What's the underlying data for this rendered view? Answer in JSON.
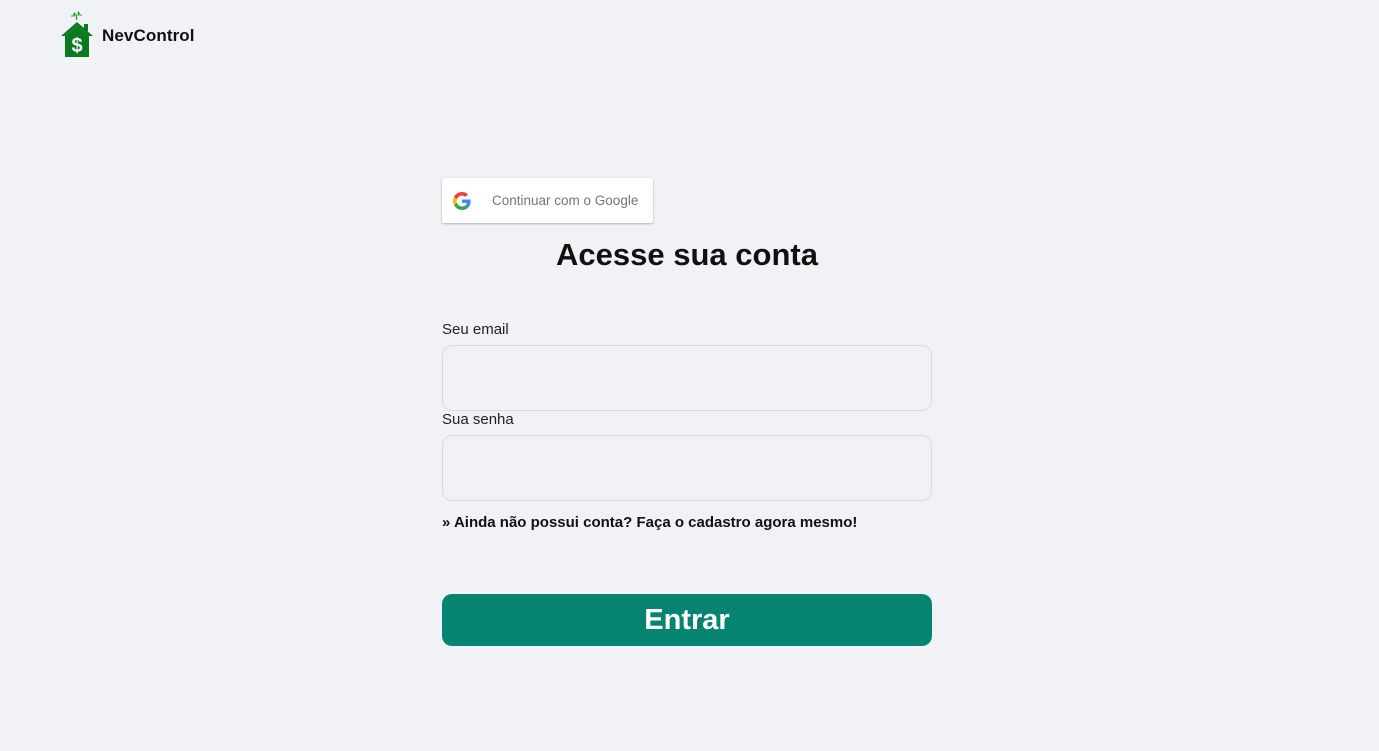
{
  "brand": {
    "name": "NevControl",
    "logo_icon": "house-dollar-icon",
    "logo_color": "#0a7a1e"
  },
  "google": {
    "label": "Continuar com o Google",
    "icon": "google-g-icon"
  },
  "login": {
    "title": "Acesse sua conta",
    "email_label": "Seu email",
    "email_value": "",
    "password_label": "Sua senha",
    "password_value": "",
    "signup_text": "» Ainda não possui conta? Faça o cadastro agora mesmo!",
    "submit_label": "Entrar"
  },
  "colors": {
    "background": "#f1f2f6",
    "primary": "#078471",
    "text": "#111111"
  }
}
